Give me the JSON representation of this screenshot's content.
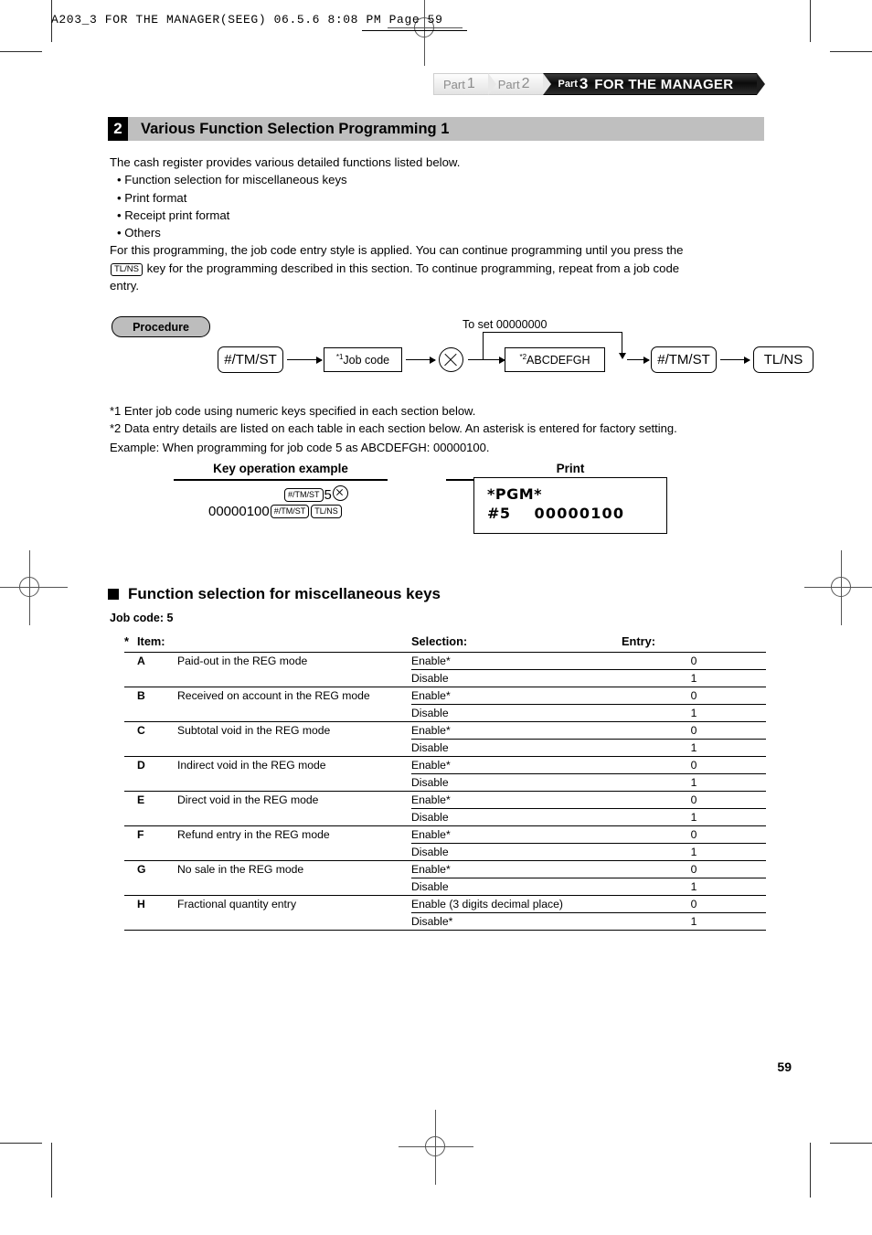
{
  "file_header": {
    "text": "A203_3 FOR THE MANAGER(SEEG)   06.5.6 8:08 PM   Page 59"
  },
  "part_banner": {
    "parts": [
      {
        "label": "Part",
        "num": "1",
        "active": false
      },
      {
        "label": "Part",
        "num": "2",
        "active": false
      },
      {
        "label": "Part",
        "num": "3",
        "title": "FOR THE MANAGER",
        "active": true
      }
    ]
  },
  "section": {
    "number": "2",
    "title": "Various Function Selection Programming 1"
  },
  "intro": {
    "line1": "The cash register provides various detailed functions listed below.",
    "bullets": [
      "• Function selection for miscellaneous keys",
      "• Print format",
      "• Receipt print format",
      "• Others"
    ],
    "para_a": "For this programming, the job code entry style is applied.  You can continue programming until you press the",
    "key_inline": "TL/NS",
    "para_b": "key for the programming described in this section.  To continue programming, repeat from a job code",
    "para_c": "entry."
  },
  "procedure": {
    "badge": "Procedure",
    "to_set_label": "To set  00000000",
    "nodes": {
      "key1": "#/TM/ST",
      "jobcode_sup": "*1",
      "jobcode": "Job code",
      "multiply_icon": "multiply-circle-icon",
      "abcdefgh_sup": "*2",
      "abcdefgh": "ABCDEFGH",
      "key2": "#/TM/ST",
      "key3": "TL/NS"
    }
  },
  "footnotes": {
    "note1": "*1  Enter job code using numeric keys specified in each section below.",
    "note2": "*2  Data entry details are listed on each table in each section below.  An asterisk is entered for factory setting.",
    "example": "Example:  When programming for job code 5 as ABCDEFGH: 00000100."
  },
  "example_block": {
    "key_op_header": "Key operation example",
    "print_header": "Print",
    "key_op_line1": {
      "key1": "#/TM/ST",
      "digit": "5",
      "circle": "multiply-circle-icon"
    },
    "key_op_line2": {
      "number": "00000100",
      "key1": "#/TM/ST",
      "key2": "TL/NS"
    },
    "print_line1": "*PGM*",
    "print_line2_label": "#5",
    "print_line2_value": "00000100"
  },
  "subsection": {
    "title": "Function selection for miscellaneous keys",
    "job_code_label": "Job code:  5"
  },
  "table": {
    "headers": {
      "star": "*",
      "item": "Item:",
      "selection": "Selection:",
      "entry": "Entry:"
    },
    "rows": [
      {
        "letter": "A",
        "item": "Paid-out in the REG mode",
        "options": [
          {
            "selection": "Enable*",
            "entry": "0"
          },
          {
            "selection": "Disable",
            "entry": "1"
          }
        ]
      },
      {
        "letter": "B",
        "item": "Received on account in the REG mode",
        "options": [
          {
            "selection": "Enable*",
            "entry": "0"
          },
          {
            "selection": "Disable",
            "entry": "1"
          }
        ]
      },
      {
        "letter": "C",
        "item": "Subtotal void in the REG mode",
        "options": [
          {
            "selection": "Enable*",
            "entry": "0"
          },
          {
            "selection": "Disable",
            "entry": "1"
          }
        ]
      },
      {
        "letter": "D",
        "item": "Indirect void in the REG mode",
        "options": [
          {
            "selection": "Enable*",
            "entry": "0"
          },
          {
            "selection": "Disable",
            "entry": "1"
          }
        ]
      },
      {
        "letter": "E",
        "item": "Direct void in the REG mode",
        "options": [
          {
            "selection": "Enable*",
            "entry": "0"
          },
          {
            "selection": "Disable",
            "entry": "1"
          }
        ]
      },
      {
        "letter": "F",
        "item": "Refund entry in the REG mode",
        "options": [
          {
            "selection": "Enable*",
            "entry": "0"
          },
          {
            "selection": "Disable",
            "entry": "1"
          }
        ]
      },
      {
        "letter": "G",
        "item": "No sale in the REG mode",
        "options": [
          {
            "selection": "Enable*",
            "entry": "0"
          },
          {
            "selection": "Disable",
            "entry": "1"
          }
        ]
      },
      {
        "letter": "H",
        "item": "Fractional quantity entry",
        "options": [
          {
            "selection": "Enable (3 digits decimal place)",
            "entry": "0"
          },
          {
            "selection": "Disable*",
            "entry": "1"
          }
        ]
      }
    ]
  },
  "footer": {
    "page_number": "59"
  }
}
